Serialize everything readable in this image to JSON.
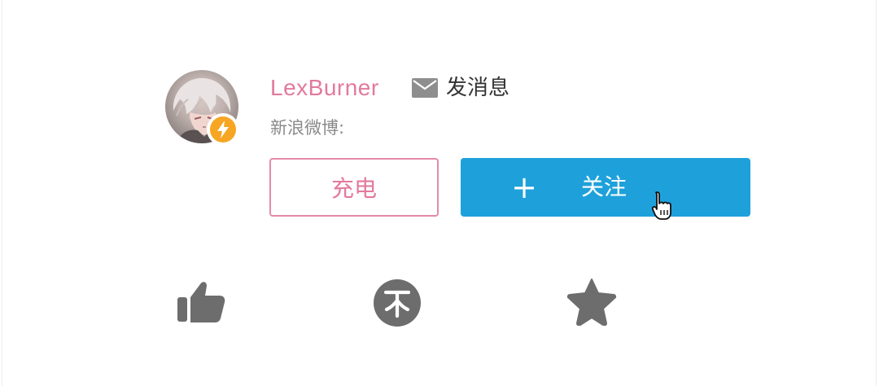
{
  "user": {
    "name": "LexBurner",
    "message_label": "发消息",
    "weibo_label": "新浪微博:"
  },
  "buttons": {
    "charge_label": "充电",
    "follow_plus": "+",
    "follow_label": "关注"
  },
  "icons": {
    "message": "mail-icon",
    "badge": "lightning-icon",
    "like": "thumbs-up-icon",
    "coin": "coin-icon",
    "favorite": "star-icon",
    "cursor": "hand-pointer-cursor"
  },
  "colors": {
    "username": "#e27a9c",
    "charge_border": "#e58aa7",
    "follow_bg": "#1ea1db",
    "badge": "#f6a623",
    "action_icons": "#6d6d6d"
  }
}
